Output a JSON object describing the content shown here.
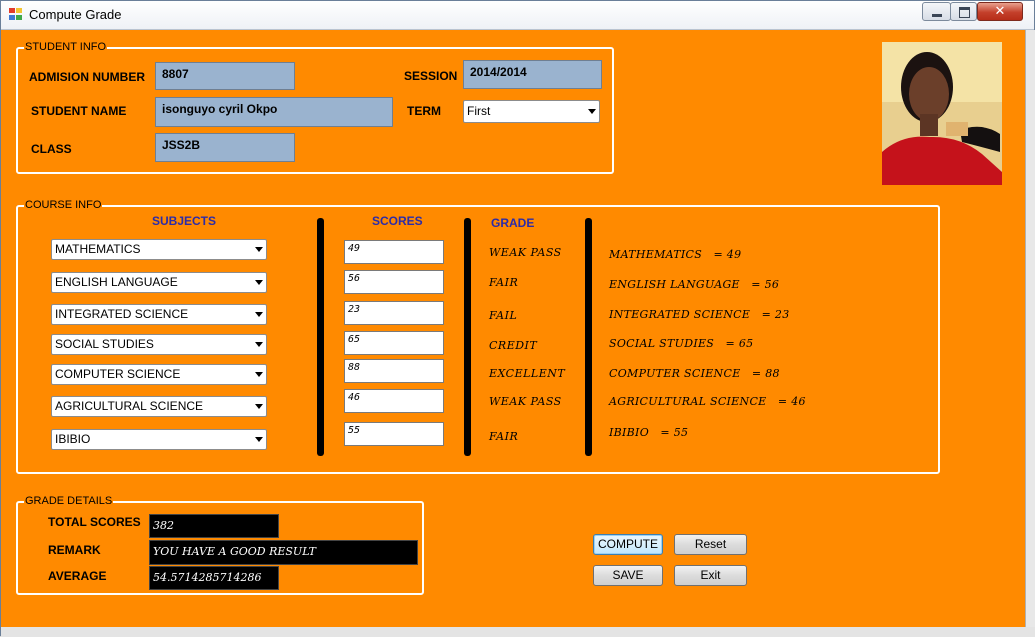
{
  "window": {
    "title": "Compute Grade"
  },
  "student_info": {
    "legend": "STUDENT INFO",
    "admission_label": "ADMISION NUMBER",
    "admission_value": "8807",
    "name_label": "STUDENT NAME",
    "name_value": "isonguyo cyril Okpo",
    "class_label": "CLASS",
    "class_value": "JSS2B",
    "session_label": "SESSION",
    "session_value": "2014/2014",
    "term_label": "TERM",
    "term_value": "First"
  },
  "course_info": {
    "legend": "COURSE INFO",
    "subjects_header": "SUBJECTS",
    "scores_header": "SCORES",
    "grade_header": "GRADE",
    "rows": [
      {
        "subject": "MATHEMATICS",
        "score": "49",
        "grade": "WEAK PASS",
        "summary": "MATHEMATICS   = 49"
      },
      {
        "subject": "ENGLISH LANGUAGE",
        "score": "56",
        "grade": "FAIR",
        "summary": "ENGLISH LANGUAGE   = 56"
      },
      {
        "subject": "INTEGRATED SCIENCE",
        "score": "23",
        "grade": "FAIL",
        "summary": "INTEGRATED SCIENCE   = 23"
      },
      {
        "subject": "SOCIAL STUDIES",
        "score": "65",
        "grade": "CREDIT",
        "summary": "SOCIAL STUDIES   = 65"
      },
      {
        "subject": "COMPUTER SCIENCE",
        "score": "88",
        "grade": "EXCELLENT",
        "summary": "COMPUTER SCIENCE   = 88"
      },
      {
        "subject": "AGRICULTURAL SCIENCE",
        "score": "46",
        "grade": "WEAK PASS",
        "summary": "AGRICULTURAL SCIENCE   = 46"
      },
      {
        "subject": "IBIBIO",
        "score": "55",
        "grade": "FAIR",
        "summary": "IBIBIO   = 55"
      }
    ]
  },
  "grade_details": {
    "legend": "GRADE DETAILS",
    "total_label": "TOTAL SCORES",
    "total_value": "382",
    "remark_label": "REMARK",
    "remark_value": "YOU HAVE A GOOD RESULT",
    "average_label": "AVERAGE",
    "average_value": "54.5714285714286"
  },
  "buttons": {
    "compute": "COMPUTE",
    "reset": "Reset",
    "save": "SAVE",
    "exit": "Exit"
  },
  "colors": {
    "form_background": "#ff8a00",
    "field_blue": "#9ab3cf",
    "header_blue": "#2c2ca8"
  }
}
